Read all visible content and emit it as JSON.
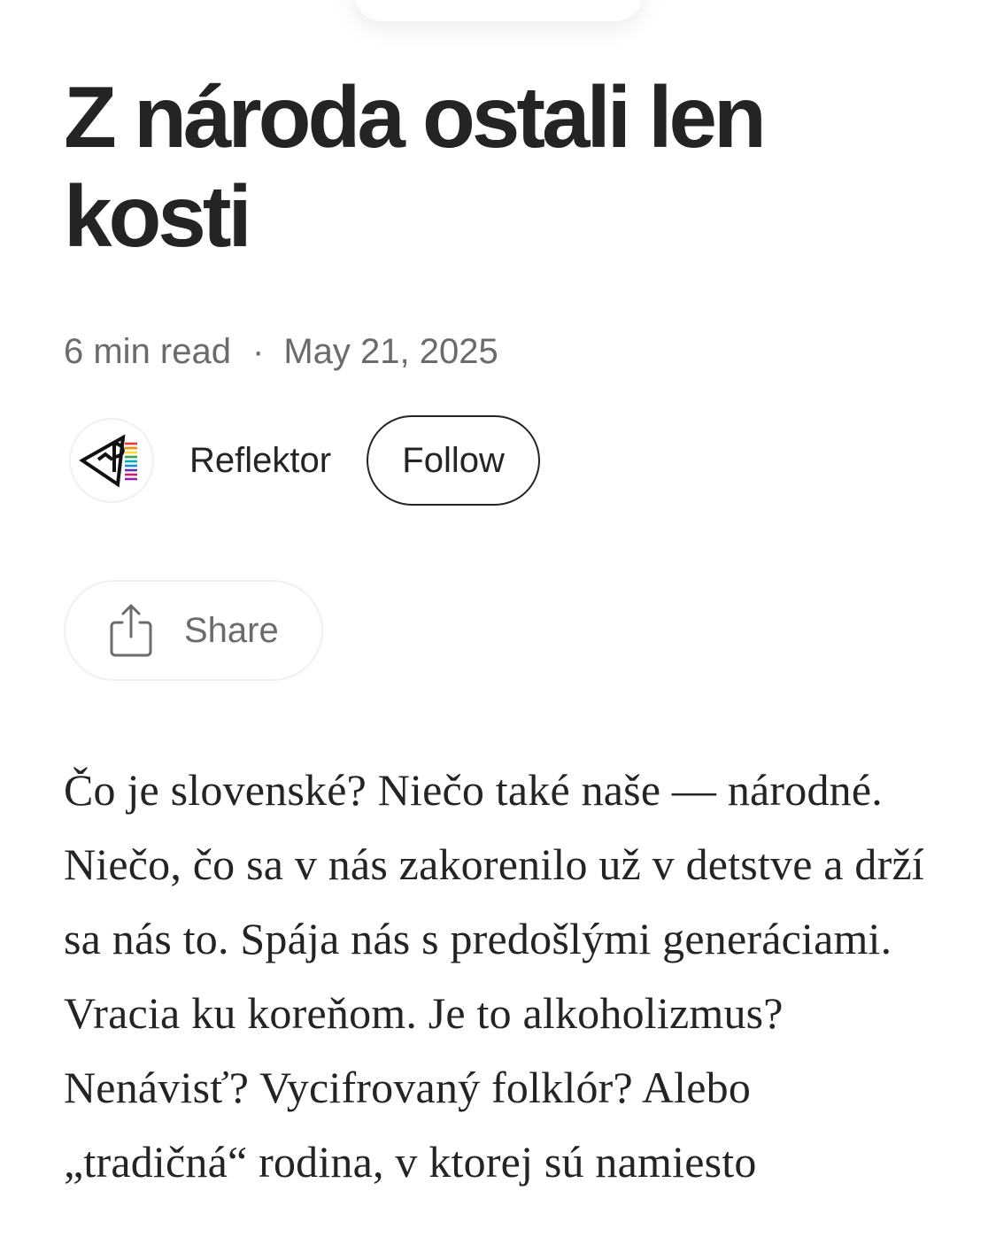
{
  "article": {
    "title": "Z národa ostali len kosti",
    "read_time": "6 min read",
    "separator": "·",
    "date": "May 21, 2025",
    "body": "Čo je slovenské? Niečo také naše — národné. Niečo, čo sa v nás zakorenilo už v detstve a drží sa nás to. Spája nás s predošlými generáciami. Vracia ku koreňom. Je to alkoholizmus? Nenávisť? Vycifrovaný folklór? Alebo „tradičná“ rodina, v ktorej sú namiesto"
  },
  "author": {
    "name": "Reflektor",
    "avatar_icon": "reflektor-logo-icon",
    "follow_label": "Follow"
  },
  "actions": {
    "share_label": "Share",
    "share_icon": "share-icon"
  },
  "colors": {
    "text_primary": "#242424",
    "text_secondary": "#6b6b6b",
    "border_light": "#f0f0f0",
    "background": "#ffffff"
  }
}
